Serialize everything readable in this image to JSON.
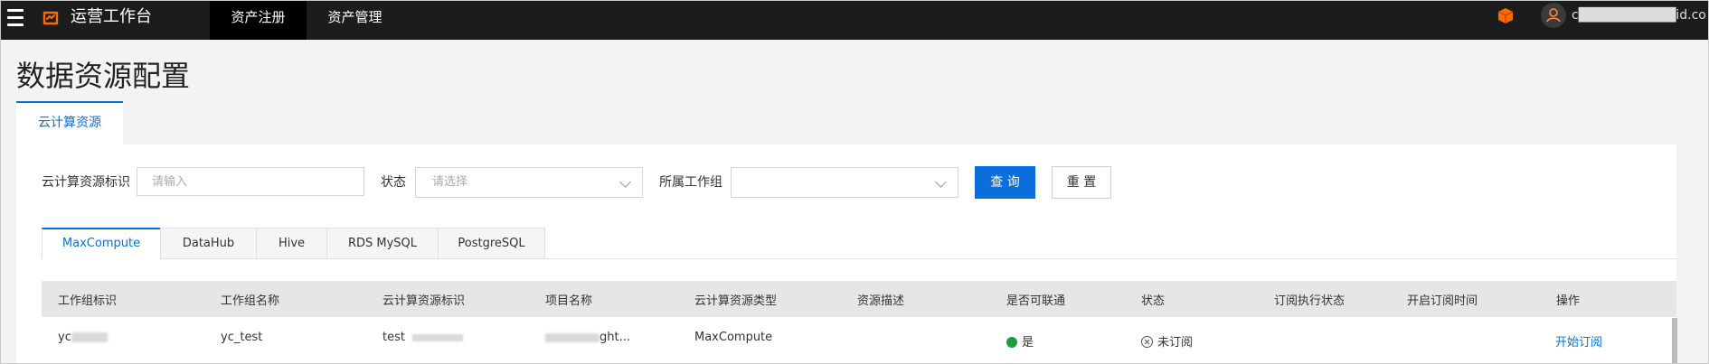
{
  "topbar": {
    "app_title": "运营工作台",
    "tabs": [
      {
        "label": "资产注册",
        "active": true
      },
      {
        "label": "资产管理",
        "active": false
      }
    ],
    "user_name": "c██████████id.co",
    "brand_color": "#ff6a00"
  },
  "page": {
    "title": "数据资源配置",
    "tab": "云计算资源"
  },
  "filters": {
    "resource_id_label": "云计算资源标识",
    "resource_id_placeholder": "请输入",
    "status_label": "状态",
    "status_placeholder": "请选择",
    "workgroup_label": "所属工作组",
    "workgroup_value": "",
    "query_button": "查 询",
    "reset_button": "重 置"
  },
  "sub_tabs": [
    {
      "label": "MaxCompute",
      "active": true
    },
    {
      "label": "DataHub",
      "active": false
    },
    {
      "label": "Hive",
      "active": false
    },
    {
      "label": "RDS MySQL",
      "active": false
    },
    {
      "label": "PostgreSQL",
      "active": false
    }
  ],
  "table": {
    "columns": [
      "工作组标识",
      "工作组名称",
      "云计算资源标识",
      "项目名称",
      "云计算资源类型",
      "资源描述",
      "是否可联通",
      "状态",
      "订阅执行状态",
      "开启订阅时间",
      "操作"
    ],
    "rows": [
      {
        "workgroup_id": "yc",
        "workgroup_name": "yc_test",
        "resource_id": "test",
        "project_name": "ght...",
        "resource_type": "MaxCompute",
        "description": "",
        "connectable": "是",
        "status": "未订阅",
        "subscription_status": "",
        "subscription_time": "",
        "action": "开始订阅"
      }
    ]
  },
  "colors": {
    "accent": "#0a6fdc",
    "topbar": "#1c1c1c",
    "connect_ok": "#1e9b3a"
  }
}
